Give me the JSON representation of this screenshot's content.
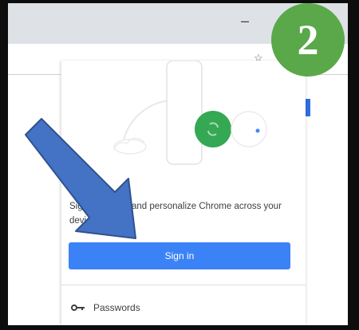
{
  "browser": {
    "minimize_symbol": "–",
    "bookmark_star_symbol": "☆"
  },
  "profile_menu": {
    "promo_text": "Sign in to sync and personalize Chrome across your devices",
    "sign_in_label": "Sign in",
    "items": [
      {
        "icon": "key-icon",
        "label": "Passwords"
      }
    ]
  },
  "annotation": {
    "step_number": "2",
    "arrow_color": "#4472c4",
    "badge_color": "#5aa84a"
  },
  "colors": {
    "sign_in_button": "#3b82f6",
    "illustration_green": "#34a853",
    "illustration_yellow": "#fbbc04"
  }
}
